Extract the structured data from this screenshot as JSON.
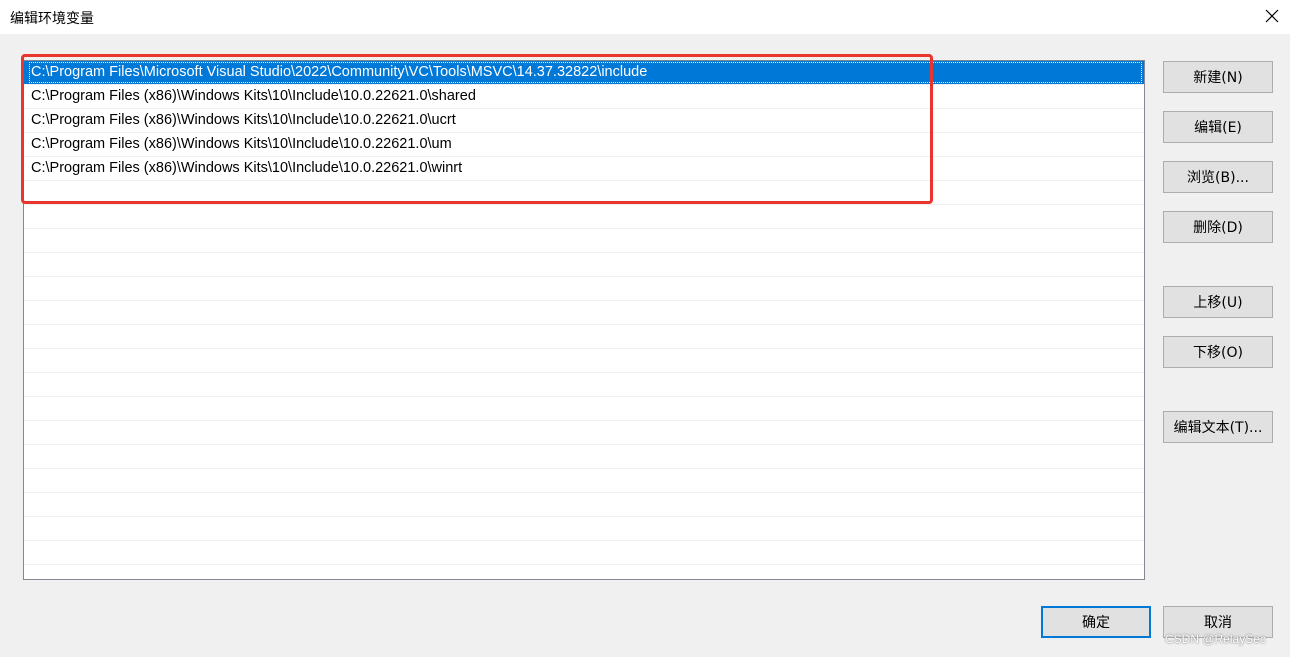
{
  "window": {
    "title": "编辑环境变量",
    "close_icon": "close-icon"
  },
  "list": {
    "items": [
      {
        "label": "C:\\Program Files\\Microsoft Visual Studio\\2022\\Community\\VC\\Tools\\MSVC\\14.37.32822\\include",
        "selected": true
      },
      {
        "label": "C:\\Program Files (x86)\\Windows Kits\\10\\Include\\10.0.22621.0\\shared",
        "selected": false
      },
      {
        "label": "C:\\Program Files (x86)\\Windows Kits\\10\\Include\\10.0.22621.0\\ucrt",
        "selected": false
      },
      {
        "label": "C:\\Program Files (x86)\\Windows Kits\\10\\Include\\10.0.22621.0\\um",
        "selected": false
      },
      {
        "label": "C:\\Program Files (x86)\\Windows Kits\\10\\Include\\10.0.22621.0\\winrt",
        "selected": false
      }
    ]
  },
  "buttons": {
    "new": "新建(N)",
    "edit": "编辑(E)",
    "browse": "浏览(B)...",
    "delete": "删除(D)",
    "move_up": "上移(U)",
    "move_down": "下移(O)",
    "edit_text": "编辑文本(T)...",
    "ok": "确定",
    "cancel": "取消"
  },
  "watermark": "CSDN @RelaySec",
  "colors": {
    "selection": "#0078d7",
    "annotation_box": "#e8352d"
  }
}
